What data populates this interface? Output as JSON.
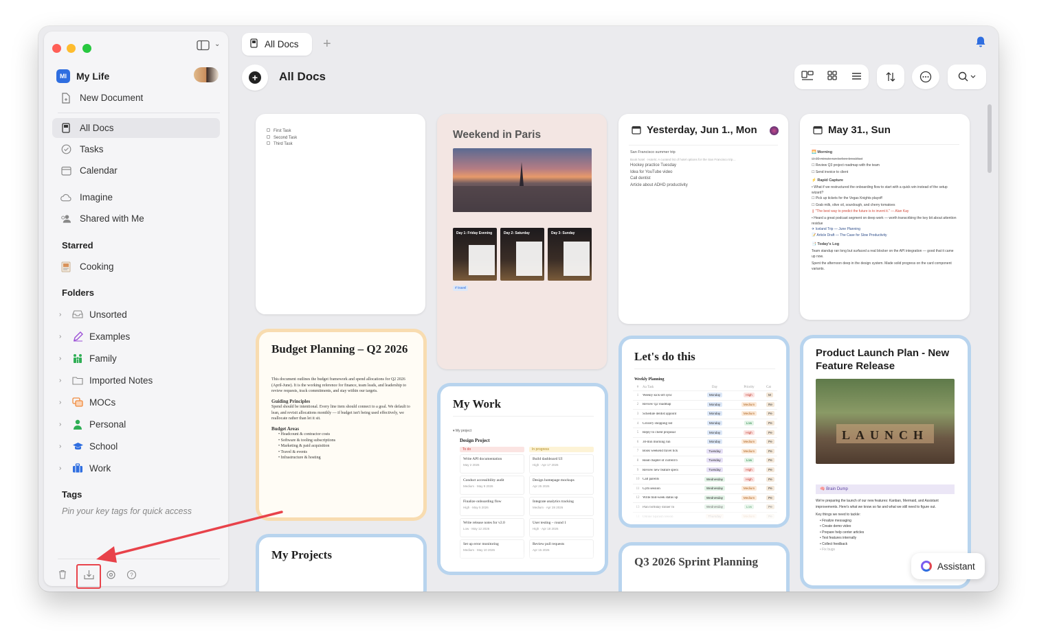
{
  "sidebar": {
    "workspace": {
      "badge": "MI",
      "name": "My Life"
    },
    "new_document": "New Document",
    "nav": [
      {
        "label": "All Docs",
        "icon": "doc-icon"
      },
      {
        "label": "Tasks",
        "icon": "check-circle-icon"
      },
      {
        "label": "Calendar",
        "icon": "calendar-icon"
      },
      {
        "label": "Imagine",
        "icon": "cloud-icon"
      },
      {
        "label": "Shared with Me",
        "icon": "people-icon"
      }
    ],
    "starred_title": "Starred",
    "starred": [
      {
        "label": "Cooking",
        "icon": "recipe-icon"
      }
    ],
    "folders_title": "Folders",
    "folders": [
      {
        "label": "Unsorted",
        "icon": "inbox-icon",
        "color": "#8a8a8a"
      },
      {
        "label": "Examples",
        "icon": "pen-icon",
        "color": "#9b4fd6"
      },
      {
        "label": "Family",
        "icon": "family-icon",
        "color": "#2fae55"
      },
      {
        "label": "Imported Notes",
        "icon": "folder-icon",
        "color": "#8a8a8a"
      },
      {
        "label": "MOCs",
        "icon": "stack-icon",
        "color": "#f08a3c"
      },
      {
        "label": "Personal",
        "icon": "person-icon",
        "color": "#2fae55"
      },
      {
        "label": "School",
        "icon": "graduation-cap-icon",
        "color": "#2f6ee0"
      },
      {
        "label": "Work",
        "icon": "briefcase-icon",
        "color": "#2f6ee0"
      }
    ],
    "tags_title": "Tags",
    "tags_hint": "Pin your key tags for quick access"
  },
  "tabs": [
    {
      "label": "All Docs"
    }
  ],
  "header": {
    "title": "All Docs"
  },
  "assistant_label": "Assistant",
  "cards": {
    "tasks": {
      "items": [
        "First Task",
        "Second Task",
        "Third Task"
      ]
    },
    "paris": {
      "title": "Weekend in Paris",
      "days": [
        "Day 1: Friday Evening",
        "Day 2: Saturday",
        "Day 3: Sunday"
      ],
      "tag": "# travel"
    },
    "yesterday": {
      "title": "Yesterday, Jun 1., Mon",
      "lines": [
        "San Francisco summer trip",
        "Hockey practice Tuesday",
        "Idea for YouTube video",
        "Call dentist",
        "Article about ADHD productivity"
      ]
    },
    "may31": {
      "title": "May 31., Sun",
      "morning": "Morning",
      "morning_items": [
        "30-minute run before breakfast",
        "Review Q3 project roadmap with the team",
        "Send invoice to client"
      ],
      "rapid": "Rapid Capture",
      "rapid_items": [
        "What if we restructured the onboarding flow to start with a quick win instead of the setup wizard?",
        "Pick up tickets for the Vegas Knights playoff",
        "Grab milk, olive oil, sourdough, and cherry tomatoes",
        "\"The best way to predict the future is to invent it.\" — Alan Kay",
        "Heard a great podcast segment on deep work — worth transcribing the key bit about attention residue",
        "Iceland Trip — June Planning",
        "Article Draft — The Case for Slow Productivity"
      ],
      "log": "Today's Log",
      "log_items": [
        "Team standup ran long but surfaced a real blocker on the API integration — good that it came up now.",
        "Spent the afternoon deep in the design system. Made solid progress on the card component variants."
      ]
    },
    "budget": {
      "title": "Budget Planning – Q2 2026",
      "intro": "This document outlines the budget framework and spend allocations for Q2 2026 (April-June). It is the working reference for finance, team leads, and leadership to review requests, track commitments, and stay within our targets.",
      "h1": "Guiding Principles",
      "p1": "Spend should be intentional. Every line item should connect to a goal. We default to lean, and revisit allocations monthly — if budget isn't being used effectively, we reallocate rather than let it sit.",
      "h2": "Budget Areas",
      "areas": [
        "Headcount & contractor costs",
        "Software & tooling subscriptions",
        "Marketing & paid acquisition",
        "Travel & events",
        "Infrastructure & hosting"
      ]
    },
    "mywork": {
      "title": "My Work",
      "crumb": "My project",
      "subtitle": "Design Project",
      "todo_label": "To do",
      "todo": [
        [
          "Write API documentation",
          "May 2 2026"
        ],
        [
          "Conduct accessibility audit",
          "Medium · May 9 2026"
        ],
        [
          "Finalize onboarding flow",
          "High · May 5 2026"
        ],
        [
          "Write release notes for v2.0",
          "Low · May 12 2026"
        ],
        [
          "Set up error monitoring",
          "Medium · May 10 2026"
        ]
      ],
      "progress_label": "In progress",
      "progress": [
        [
          "Build dashboard UI",
          "High · Apr 17 2026"
        ],
        [
          "Design homepage mockups",
          "Apr 25 2026"
        ],
        [
          "Integrate analytics tracking",
          "Medium · Apr 28 2026"
        ],
        [
          "User testing – round 1",
          "High · Apr 18 2026"
        ],
        [
          "Review pull requests",
          "Apr 15 2026"
        ]
      ]
    },
    "letsdo": {
      "title": "Let's do this",
      "subtitle": "Weekly Planning",
      "columns": [
        "#",
        "Aa Task",
        "Day",
        "Priority",
        "Cat"
      ],
      "rows": [
        [
          "1",
          "Weekly kick-off sync",
          "Monday",
          "High",
          "M"
        ],
        [
          "2",
          "Review Q2 roadmap",
          "Monday",
          "Medium",
          "Re"
        ],
        [
          "3",
          "Schedule dentist appoint",
          "Monday",
          "Medium",
          "Pe"
        ],
        [
          "4",
          "Grocery shopping list",
          "Monday",
          "Low",
          "Pe"
        ],
        [
          "5",
          "Reply to client proposal",
          "Monday",
          "High",
          "Pe"
        ],
        [
          "6",
          "30-min morning run",
          "Monday",
          "Medium",
          "Pe"
        ],
        [
          "7",
          "Book weekend travel tick",
          "Tuesday",
          "Medium",
          "Pe"
        ],
        [
          "8",
          "Read chapter of current b",
          "Tuesday",
          "Low",
          "Pe"
        ],
        [
          "9",
          "Review new feature specs",
          "Tuesday",
          "High",
          "Pe"
        ],
        [
          "10",
          "Call parents",
          "Wednesday",
          "High",
          "Pe"
        ],
        [
          "11",
          "Gym session",
          "Wednesday",
          "Medium",
          "Pe"
        ],
        [
          "12",
          "Write mid-week status up",
          "Wednesday",
          "Medium",
          "Pe"
        ],
        [
          "13",
          "Plan birthday dinner fo",
          "Wednesday",
          "Low",
          "Pe"
        ],
        [
          "14",
          "Online Spanish lesson",
          "Thursday",
          "Medium",
          "Pe"
        ]
      ]
    },
    "launch": {
      "title": "Product Launch Plan - New Feature Release",
      "image_text": "LAUNCH",
      "brain": "Brain Dump",
      "text": "We're preparing the launch of our new features: Kanban, Mermaid, and Assistant improvements. Here's what we know so far and what we still need to figure out.",
      "key": "Key things we need to tackle:",
      "items": [
        "Finalize messaging",
        "Create demo video",
        "Prepare help center articles",
        "Test features internally",
        "Collect feedback",
        "Fix bugs"
      ]
    },
    "projects": {
      "title": "My Projects"
    },
    "sprint": {
      "title": "Q3 2026 Sprint Planning"
    }
  },
  "colors": {
    "accent": "#2f6ee0",
    "highlight": "#e8424a",
    "card_blue_border": "#b8d4ee",
    "card_orange_border": "#f8dcb0"
  }
}
